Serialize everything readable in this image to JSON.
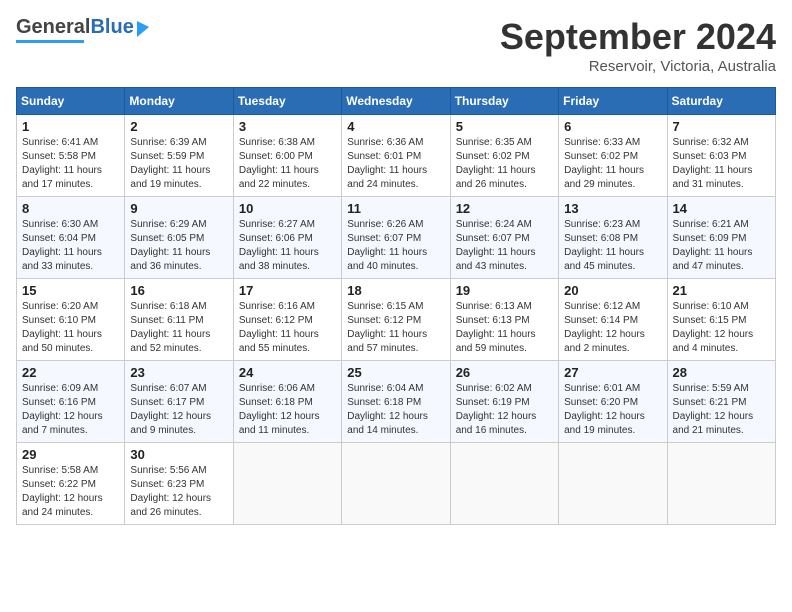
{
  "header": {
    "logo_general": "General",
    "logo_blue": "Blue",
    "month_title": "September 2024",
    "subtitle": "Reservoir, Victoria, Australia"
  },
  "calendar": {
    "days_of_week": [
      "Sunday",
      "Monday",
      "Tuesday",
      "Wednesday",
      "Thursday",
      "Friday",
      "Saturday"
    ],
    "weeks": [
      [
        {
          "day": "",
          "info": ""
        },
        {
          "day": "2",
          "sunrise": "Sunrise: 6:39 AM",
          "sunset": "Sunset: 5:59 PM",
          "daylight": "Daylight: 11 hours and 19 minutes."
        },
        {
          "day": "3",
          "sunrise": "Sunrise: 6:38 AM",
          "sunset": "Sunset: 6:00 PM",
          "daylight": "Daylight: 11 hours and 22 minutes."
        },
        {
          "day": "4",
          "sunrise": "Sunrise: 6:36 AM",
          "sunset": "Sunset: 6:01 PM",
          "daylight": "Daylight: 11 hours and 24 minutes."
        },
        {
          "day": "5",
          "sunrise": "Sunrise: 6:35 AM",
          "sunset": "Sunset: 6:02 PM",
          "daylight": "Daylight: 11 hours and 26 minutes."
        },
        {
          "day": "6",
          "sunrise": "Sunrise: 6:33 AM",
          "sunset": "Sunset: 6:02 PM",
          "daylight": "Daylight: 11 hours and 29 minutes."
        },
        {
          "day": "7",
          "sunrise": "Sunrise: 6:32 AM",
          "sunset": "Sunset: 6:03 PM",
          "daylight": "Daylight: 11 hours and 31 minutes."
        }
      ],
      [
        {
          "day": "8",
          "sunrise": "Sunrise: 6:30 AM",
          "sunset": "Sunset: 6:04 PM",
          "daylight": "Daylight: 11 hours and 33 minutes."
        },
        {
          "day": "9",
          "sunrise": "Sunrise: 6:29 AM",
          "sunset": "Sunset: 6:05 PM",
          "daylight": "Daylight: 11 hours and 36 minutes."
        },
        {
          "day": "10",
          "sunrise": "Sunrise: 6:27 AM",
          "sunset": "Sunset: 6:06 PM",
          "daylight": "Daylight: 11 hours and 38 minutes."
        },
        {
          "day": "11",
          "sunrise": "Sunrise: 6:26 AM",
          "sunset": "Sunset: 6:07 PM",
          "daylight": "Daylight: 11 hours and 40 minutes."
        },
        {
          "day": "12",
          "sunrise": "Sunrise: 6:24 AM",
          "sunset": "Sunset: 6:07 PM",
          "daylight": "Daylight: 11 hours and 43 minutes."
        },
        {
          "day": "13",
          "sunrise": "Sunrise: 6:23 AM",
          "sunset": "Sunset: 6:08 PM",
          "daylight": "Daylight: 11 hours and 45 minutes."
        },
        {
          "day": "14",
          "sunrise": "Sunrise: 6:21 AM",
          "sunset": "Sunset: 6:09 PM",
          "daylight": "Daylight: 11 hours and 47 minutes."
        }
      ],
      [
        {
          "day": "15",
          "sunrise": "Sunrise: 6:20 AM",
          "sunset": "Sunset: 6:10 PM",
          "daylight": "Daylight: 11 hours and 50 minutes."
        },
        {
          "day": "16",
          "sunrise": "Sunrise: 6:18 AM",
          "sunset": "Sunset: 6:11 PM",
          "daylight": "Daylight: 11 hours and 52 minutes."
        },
        {
          "day": "17",
          "sunrise": "Sunrise: 6:16 AM",
          "sunset": "Sunset: 6:12 PM",
          "daylight": "Daylight: 11 hours and 55 minutes."
        },
        {
          "day": "18",
          "sunrise": "Sunrise: 6:15 AM",
          "sunset": "Sunset: 6:12 PM",
          "daylight": "Daylight: 11 hours and 57 minutes."
        },
        {
          "day": "19",
          "sunrise": "Sunrise: 6:13 AM",
          "sunset": "Sunset: 6:13 PM",
          "daylight": "Daylight: 11 hours and 59 minutes."
        },
        {
          "day": "20",
          "sunrise": "Sunrise: 6:12 AM",
          "sunset": "Sunset: 6:14 PM",
          "daylight": "Daylight: 12 hours and 2 minutes."
        },
        {
          "day": "21",
          "sunrise": "Sunrise: 6:10 AM",
          "sunset": "Sunset: 6:15 PM",
          "daylight": "Daylight: 12 hours and 4 minutes."
        }
      ],
      [
        {
          "day": "22",
          "sunrise": "Sunrise: 6:09 AM",
          "sunset": "Sunset: 6:16 PM",
          "daylight": "Daylight: 12 hours and 7 minutes."
        },
        {
          "day": "23",
          "sunrise": "Sunrise: 6:07 AM",
          "sunset": "Sunset: 6:17 PM",
          "daylight": "Daylight: 12 hours and 9 minutes."
        },
        {
          "day": "24",
          "sunrise": "Sunrise: 6:06 AM",
          "sunset": "Sunset: 6:18 PM",
          "daylight": "Daylight: 12 hours and 11 minutes."
        },
        {
          "day": "25",
          "sunrise": "Sunrise: 6:04 AM",
          "sunset": "Sunset: 6:18 PM",
          "daylight": "Daylight: 12 hours and 14 minutes."
        },
        {
          "day": "26",
          "sunrise": "Sunrise: 6:02 AM",
          "sunset": "Sunset: 6:19 PM",
          "daylight": "Daylight: 12 hours and 16 minutes."
        },
        {
          "day": "27",
          "sunrise": "Sunrise: 6:01 AM",
          "sunset": "Sunset: 6:20 PM",
          "daylight": "Daylight: 12 hours and 19 minutes."
        },
        {
          "day": "28",
          "sunrise": "Sunrise: 5:59 AM",
          "sunset": "Sunset: 6:21 PM",
          "daylight": "Daylight: 12 hours and 21 minutes."
        }
      ],
      [
        {
          "day": "29",
          "sunrise": "Sunrise: 5:58 AM",
          "sunset": "Sunset: 6:22 PM",
          "daylight": "Daylight: 12 hours and 24 minutes."
        },
        {
          "day": "30",
          "sunrise": "Sunrise: 5:56 AM",
          "sunset": "Sunset: 6:23 PM",
          "daylight": "Daylight: 12 hours and 26 minutes."
        },
        {
          "day": "",
          "info": ""
        },
        {
          "day": "",
          "info": ""
        },
        {
          "day": "",
          "info": ""
        },
        {
          "day": "",
          "info": ""
        },
        {
          "day": "",
          "info": ""
        }
      ]
    ],
    "first_week_day1": {
      "day": "1",
      "sunrise": "Sunrise: 6:41 AM",
      "sunset": "Sunset: 5:58 PM",
      "daylight": "Daylight: 11 hours and 17 minutes."
    }
  }
}
